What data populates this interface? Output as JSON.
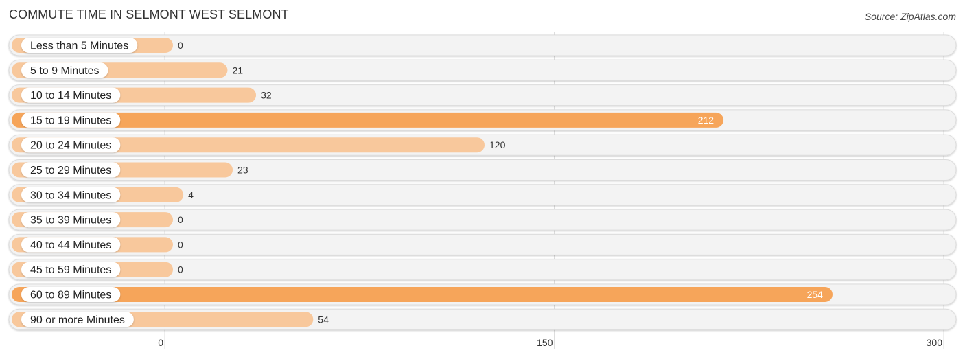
{
  "header": {
    "title": "COMMUTE TIME IN SELMONT WEST SELMONT",
    "source": "Source: ZipAtlas.com"
  },
  "colors": {
    "bar_light": "#f8c89c",
    "bar_strong": "#f6a55a",
    "track": "#f3f3f3",
    "grid": "#dddddd"
  },
  "chart_data": {
    "type": "bar",
    "orientation": "horizontal",
    "title": "COMMUTE TIME IN SELMONT WEST SELMONT",
    "categories": [
      "Less than 5 Minutes",
      "5 to 9 Minutes",
      "10 to 14 Minutes",
      "15 to 19 Minutes",
      "20 to 24 Minutes",
      "25 to 29 Minutes",
      "30 to 34 Minutes",
      "35 to 39 Minutes",
      "40 to 44 Minutes",
      "45 to 59 Minutes",
      "60 to 89 Minutes",
      "90 or more Minutes"
    ],
    "values": [
      0,
      21,
      32,
      212,
      120,
      23,
      4,
      0,
      0,
      0,
      254,
      54
    ],
    "xlim": [
      0,
      300
    ],
    "xticks": [
      0,
      150,
      300
    ],
    "xlabel": "",
    "ylabel": "",
    "grid": true,
    "legend": "none"
  }
}
